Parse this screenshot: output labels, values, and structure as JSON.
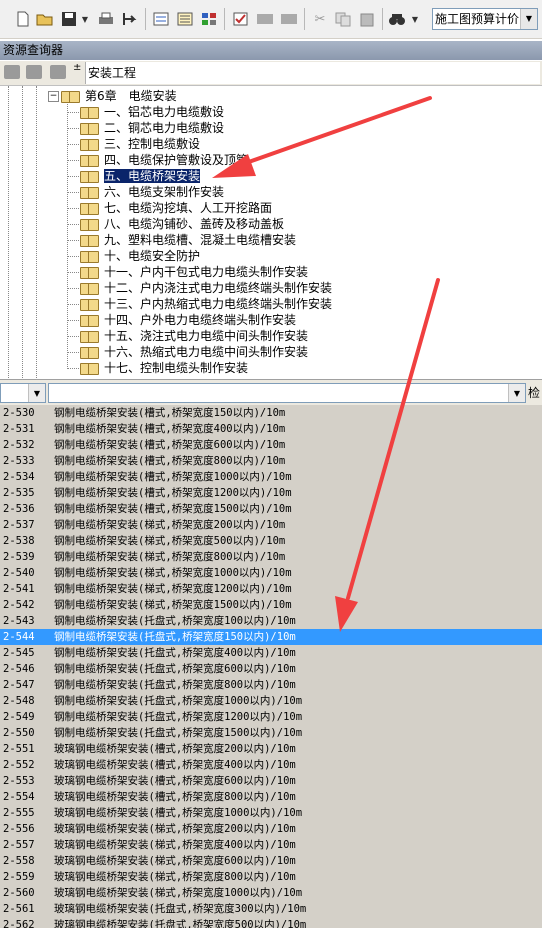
{
  "toolbar": {
    "icons": [
      "new-icon",
      "open-icon",
      "save-icon",
      "dropdown-icon",
      "print-icon",
      "export-icon",
      "calc-icon",
      "report-icon",
      "table-icon",
      "check-icon",
      "rsf-icon",
      "edit-icon",
      "cut-icon",
      "copy-icon",
      "paste-icon",
      "binoculars-icon",
      "dropdown-icon"
    ],
    "price_mode": "施工图预算计价"
  },
  "panel": {
    "title": "资源查询器"
  },
  "library": {
    "name": "安装工程"
  },
  "tree": {
    "chapter": "第6章　电缆安装",
    "sections": [
      "一、铝芯电力电缆敷设",
      "二、铜芯电力电缆敷设",
      "三、控制电缆敷设",
      "四、电缆保护管敷设及顶管",
      "五、电缆桥架安装",
      "六、电缆支架制作安装",
      "七、电缆沟挖填、人工开挖路面",
      "八、电缆沟铺砂、盖砖及移动盖板",
      "九、塑料电缆槽、混凝土电缆槽安装",
      "十、电缆安全防护",
      "十一、户内干包式电力电缆头制作安装",
      "十二、户内浇注式电力电缆终端头制作安装",
      "十三、户内热缩式电力电缆终端头制作安装",
      "十四、户外电力电缆终端头制作安装",
      "十五、浇注式电力电缆中间头制作安装",
      "十六、热缩式电力电缆中间头制作安装",
      "十七、控制电缆头制作安装"
    ],
    "selected_index": 4
  },
  "filter": {
    "search_label": "检"
  },
  "items": [
    {
      "code": "2-530",
      "name": "钢制电缆桥架安装(槽式,桥架宽度150以内)/10m"
    },
    {
      "code": "2-531",
      "name": "钢制电缆桥架安装(槽式,桥架宽度400以内)/10m"
    },
    {
      "code": "2-532",
      "name": "钢制电缆桥架安装(槽式,桥架宽度600以内)/10m"
    },
    {
      "code": "2-533",
      "name": "钢制电缆桥架安装(槽式,桥架宽度800以内)/10m"
    },
    {
      "code": "2-534",
      "name": "钢制电缆桥架安装(槽式,桥架宽度1000以内)/10m"
    },
    {
      "code": "2-535",
      "name": "钢制电缆桥架安装(槽式,桥架宽度1200以内)/10m"
    },
    {
      "code": "2-536",
      "name": "钢制电缆桥架安装(槽式,桥架宽度1500以内)/10m"
    },
    {
      "code": "2-537",
      "name": "钢制电缆桥架安装(梯式,桥架宽度200以内)/10m"
    },
    {
      "code": "2-538",
      "name": "钢制电缆桥架安装(梯式,桥架宽度500以内)/10m"
    },
    {
      "code": "2-539",
      "name": "钢制电缆桥架安装(梯式,桥架宽度800以内)/10m"
    },
    {
      "code": "2-540",
      "name": "钢制电缆桥架安装(梯式,桥架宽度1000以内)/10m"
    },
    {
      "code": "2-541",
      "name": "钢制电缆桥架安装(梯式,桥架宽度1200以内)/10m"
    },
    {
      "code": "2-542",
      "name": "钢制电缆桥架安装(梯式,桥架宽度1500以内)/10m"
    },
    {
      "code": "2-543",
      "name": "钢制电缆桥架安装(托盘式,桥架宽度100以内)/10m"
    },
    {
      "code": "2-544",
      "name": "钢制电缆桥架安装(托盘式,桥架宽度150以内)/10m"
    },
    {
      "code": "2-545",
      "name": "钢制电缆桥架安装(托盘式,桥架宽度400以内)/10m"
    },
    {
      "code": "2-546",
      "name": "钢制电缆桥架安装(托盘式,桥架宽度600以内)/10m"
    },
    {
      "code": "2-547",
      "name": "钢制电缆桥架安装(托盘式,桥架宽度800以内)/10m"
    },
    {
      "code": "2-548",
      "name": "钢制电缆桥架安装(托盘式,桥架宽度1000以内)/10m"
    },
    {
      "code": "2-549",
      "name": "钢制电缆桥架安装(托盘式,桥架宽度1200以内)/10m"
    },
    {
      "code": "2-550",
      "name": "钢制电缆桥架安装(托盘式,桥架宽度1500以内)/10m"
    },
    {
      "code": "2-551",
      "name": "玻璃钢电缆桥架安装(槽式,桥架宽度200以内)/10m"
    },
    {
      "code": "2-552",
      "name": "玻璃钢电缆桥架安装(槽式,桥架宽度400以内)/10m"
    },
    {
      "code": "2-553",
      "name": "玻璃钢电缆桥架安装(槽式,桥架宽度600以内)/10m"
    },
    {
      "code": "2-554",
      "name": "玻璃钢电缆桥架安装(槽式,桥架宽度800以内)/10m"
    },
    {
      "code": "2-555",
      "name": "玻璃钢电缆桥架安装(槽式,桥架宽度1000以内)/10m"
    },
    {
      "code": "2-556",
      "name": "玻璃钢电缆桥架安装(梯式,桥架宽度200以内)/10m"
    },
    {
      "code": "2-557",
      "name": "玻璃钢电缆桥架安装(梯式,桥架宽度400以内)/10m"
    },
    {
      "code": "2-558",
      "name": "玻璃钢电缆桥架安装(梯式,桥架宽度600以内)/10m"
    },
    {
      "code": "2-559",
      "name": "玻璃钢电缆桥架安装(梯式,桥架宽度800以内)/10m"
    },
    {
      "code": "2-560",
      "name": "玻璃钢电缆桥架安装(梯式,桥架宽度1000以内)/10m"
    },
    {
      "code": "2-561",
      "name": "玻璃钢电缆桥架安装(托盘式,桥架宽度300以内)/10m"
    },
    {
      "code": "2-562",
      "name": "玻璃钢电缆桥架安装(托盘式,桥架宽度500以内)/10m"
    }
  ],
  "selected_item_index": 14,
  "colors": {
    "selection": "#3399ff",
    "list_background": "#d4d0c8",
    "annotation_arrow": "#f04040"
  }
}
